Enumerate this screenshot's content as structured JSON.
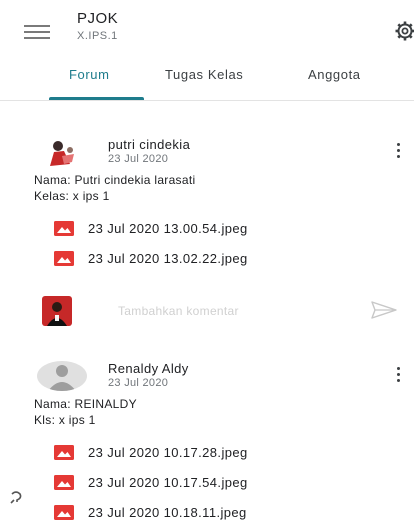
{
  "header": {
    "title": "PJOK",
    "subtitle": "X.IPS.1",
    "icons": [
      "menu-icon",
      "settings-icon"
    ]
  },
  "tabs": [
    {
      "label": "Forum",
      "active": true
    },
    {
      "label": "Tugas Kelas",
      "active": false
    },
    {
      "label": "Anggota",
      "active": false
    }
  ],
  "accent_color": "#1e7c8c",
  "attachment_icon_color": "#e53935",
  "posts": [
    {
      "author": "putri cindekia",
      "date": "23 Jul 2020",
      "body": [
        "Nama: Putri cindekia larasati",
        "Kelas: x ips 1"
      ],
      "attachments": [
        "23 Jul 2020 13.00.54.jpeg",
        "23 Jul 2020 13.02.22.jpeg"
      ]
    },
    {
      "author": "Renaldy Aldy",
      "date": "23 Jul 2020",
      "body": [
        "Nama: REINALDY",
        "Kls: x ips 1"
      ],
      "attachments": [
        "23 Jul 2020 10.17.28.jpeg",
        "23 Jul 2020 10.17.54.jpeg",
        "23 Jul 2020 10.18.11.jpeg"
      ]
    }
  ],
  "comment": {
    "placeholder": "Tambahkan komentar"
  }
}
